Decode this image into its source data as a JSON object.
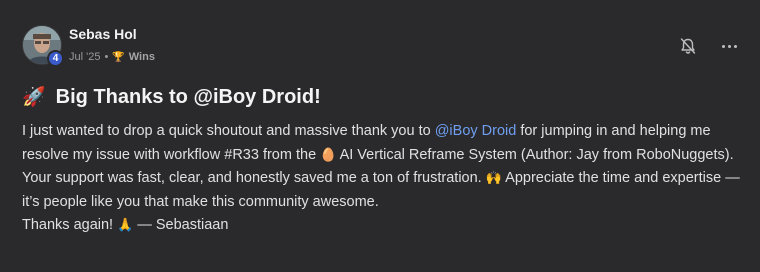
{
  "author": {
    "name": "Sebas Hol",
    "level": "4",
    "date": "Jul '25",
    "category": "Wins",
    "icons": {
      "category": "trophy-icon",
      "notify": "bell-off-icon",
      "more": "more-icon"
    }
  },
  "post": {
    "title_icon": "🚀",
    "title": "Big Thanks to @iBoy Droid!",
    "p1_a": "I just wanted to drop a quick shoutout and massive thank you to ",
    "p1_mention": "@iBoy Droid",
    "p1_b": " for jumping in and helping me resolve my issue with workflow #R33 from the ",
    "p1_emoji": "🥚",
    "p1_c": " AI Vertical Reframe System (Author: Jay from RoboNuggets).",
    "p2_a": "Your support was fast, clear, and honestly saved me a ton of frustration. ",
    "p2_emoji": "🙌",
    "p2_b": " Appreciate the time and expertise — it’s people like you that make this community awesome.",
    "p3_a": "Thanks again! ",
    "p3_emoji": "🙏",
    "p3_b": " — Sebastiaan"
  },
  "colors": {
    "background": "#2a2a2c",
    "mention": "#6f9ef0",
    "badge": "#3b5bcb"
  }
}
